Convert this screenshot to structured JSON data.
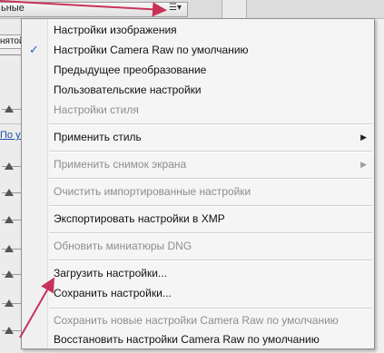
{
  "background": {
    "dropdown_text": "ьные",
    "panel_menu_icon": "list-menu-icon",
    "side_button_text": "нятой",
    "side_link_text": "По умо"
  },
  "menu": {
    "items": [
      {
        "label": "Настройки изображения",
        "checked": false,
        "disabled": false
      },
      {
        "label": "Настройки Camera Raw  по умолчанию",
        "checked": true,
        "disabled": false
      },
      {
        "label": "Предыдущее преобразование",
        "checked": false,
        "disabled": false
      },
      {
        "label": "Пользовательские настройки",
        "checked": false,
        "disabled": false
      },
      {
        "label": "Настройки стиля",
        "checked": false,
        "disabled": true
      },
      {
        "label": "Применить стиль",
        "checked": false,
        "disabled": false,
        "submenu": true
      },
      {
        "label": "Применить снимок экрана",
        "checked": false,
        "disabled": true,
        "submenu": true
      },
      {
        "label": "Очистить импортированные настройки",
        "checked": false,
        "disabled": true
      },
      {
        "label": "Экспортировать настройки в XMP",
        "checked": false,
        "disabled": false
      },
      {
        "label": "Обновить миниатюры DNG",
        "checked": false,
        "disabled": true
      },
      {
        "label": "Загрузить настройки...",
        "checked": false,
        "disabled": false
      },
      {
        "label": "Сохранить настройки...",
        "checked": false,
        "disabled": false
      },
      {
        "label": "Сохранить новые настройки Camera Raw по умолчанию",
        "checked": false,
        "disabled": true
      },
      {
        "label": "Восстановить настройки Camera Raw по умолчанию",
        "checked": false,
        "disabled": false
      }
    ],
    "check_glyph": "✓",
    "submenu_glyph": "▶"
  },
  "colors": {
    "annotation_arrow": "#c8325a",
    "check": "#1f5fbf",
    "disabled_text": "#8d8d8d"
  }
}
